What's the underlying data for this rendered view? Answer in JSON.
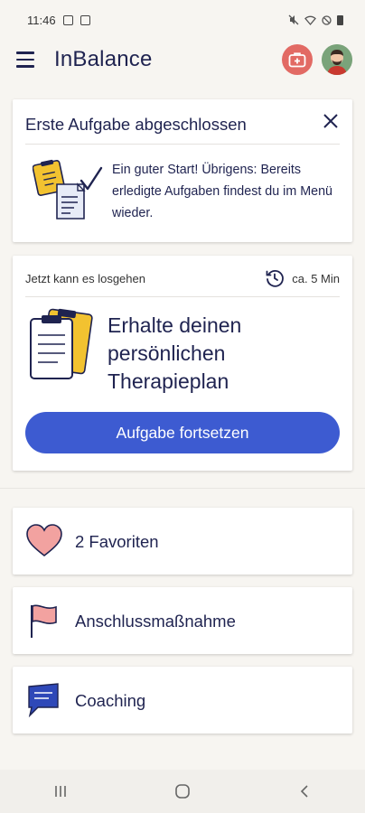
{
  "status_bar": {
    "time": "11:46"
  },
  "app_bar": {
    "title": "InBalance"
  },
  "notice": {
    "title": "Erste Aufgabe abgeschlossen",
    "text": "Ein guter Start! Übrigens: Bereits erledigte Aufgaben findest du im Menü wieder."
  },
  "task": {
    "meta": "Jetzt kann es losgehen",
    "duration": "ca. 5 Min",
    "title": "Erhalte deinen persönlichen Therapieplan",
    "button_label": "Aufgabe fortsetzen"
  },
  "list": {
    "favorites": "2 Favoriten",
    "follow_up": "Anschlussmaßnahme",
    "coaching": "Coaching"
  },
  "colors": {
    "primary": "#3d5bd1",
    "text": "#1f2350",
    "emergency": "#e26a64",
    "accent_yellow": "#f2c230",
    "heart": "#f2a2a0"
  }
}
